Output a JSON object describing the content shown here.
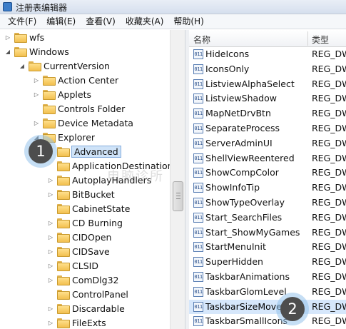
{
  "window": {
    "title": "注册表编辑器"
  },
  "menu": [
    "文件(F)",
    "编辑(E)",
    "查看(V)",
    "收藏夹(A)",
    "帮助(H)"
  ],
  "tree": [
    {
      "label": "wfs",
      "depth": 0,
      "expander": "collapsed"
    },
    {
      "label": "Windows",
      "depth": 0,
      "expander": "expanded"
    },
    {
      "label": "CurrentVersion",
      "depth": 1,
      "expander": "expanded"
    },
    {
      "label": "Action Center",
      "depth": 2,
      "expander": "collapsed"
    },
    {
      "label": "Applets",
      "depth": 2,
      "expander": "collapsed"
    },
    {
      "label": "Controls Folder",
      "depth": 2,
      "expander": "none"
    },
    {
      "label": "Device Metadata",
      "depth": 2,
      "expander": "collapsed"
    },
    {
      "label": "Explorer",
      "depth": 2,
      "expander": "expanded"
    },
    {
      "label": "Advanced",
      "depth": 3,
      "expander": "collapsed",
      "selected": true
    },
    {
      "label": "ApplicationDestinations",
      "depth": 3,
      "expander": "none"
    },
    {
      "label": "AutoplayHandlers",
      "depth": 3,
      "expander": "collapsed"
    },
    {
      "label": "BitBucket",
      "depth": 3,
      "expander": "collapsed"
    },
    {
      "label": "CabinetState",
      "depth": 3,
      "expander": "none"
    },
    {
      "label": "CD Burning",
      "depth": 3,
      "expander": "collapsed"
    },
    {
      "label": "CIDOpen",
      "depth": 3,
      "expander": "collapsed"
    },
    {
      "label": "CIDSave",
      "depth": 3,
      "expander": "collapsed"
    },
    {
      "label": "CLSID",
      "depth": 3,
      "expander": "collapsed"
    },
    {
      "label": "ComDlg32",
      "depth": 3,
      "expander": "collapsed"
    },
    {
      "label": "ControlPanel",
      "depth": 3,
      "expander": "none"
    },
    {
      "label": "Discardable",
      "depth": 3,
      "expander": "collapsed"
    },
    {
      "label": "FileExts",
      "depth": 3,
      "expander": "collapsed"
    }
  ],
  "list": {
    "header": {
      "name": "名称",
      "type": "类型"
    },
    "rows": [
      {
        "name": "HideIcons",
        "type": "REG_DW"
      },
      {
        "name": "IconsOnly",
        "type": "REG_DW"
      },
      {
        "name": "ListviewAlphaSelect",
        "type": "REG_DW"
      },
      {
        "name": "ListviewShadow",
        "type": "REG_DW"
      },
      {
        "name": "MapNetDrvBtn",
        "type": "REG_DW"
      },
      {
        "name": "SeparateProcess",
        "type": "REG_DW"
      },
      {
        "name": "ServerAdminUI",
        "type": "REG_DW"
      },
      {
        "name": "ShellViewReentered",
        "type": "REG_DW"
      },
      {
        "name": "ShowCompColor",
        "type": "REG_DW"
      },
      {
        "name": "ShowInfoTip",
        "type": "REG_DW"
      },
      {
        "name": "ShowTypeOverlay",
        "type": "REG_DW"
      },
      {
        "name": "Start_SearchFiles",
        "type": "REG_DW"
      },
      {
        "name": "Start_ShowMyGames",
        "type": "REG_DW"
      },
      {
        "name": "StartMenuInit",
        "type": "REG_DW"
      },
      {
        "name": "SuperHidden",
        "type": "REG_DW"
      },
      {
        "name": "TaskbarAnimations",
        "type": "REG_DW"
      },
      {
        "name": "TaskbarGlomLevel",
        "type": "REG_DW"
      },
      {
        "name": "TaskbarSizeMove",
        "type": "REG_DW",
        "highlight": true
      },
      {
        "name": "TaskbarSmallIcons",
        "type": "REG_DW"
      }
    ]
  },
  "badges": {
    "step1": "1",
    "step2": "2"
  },
  "watermark": "电脑诊所"
}
